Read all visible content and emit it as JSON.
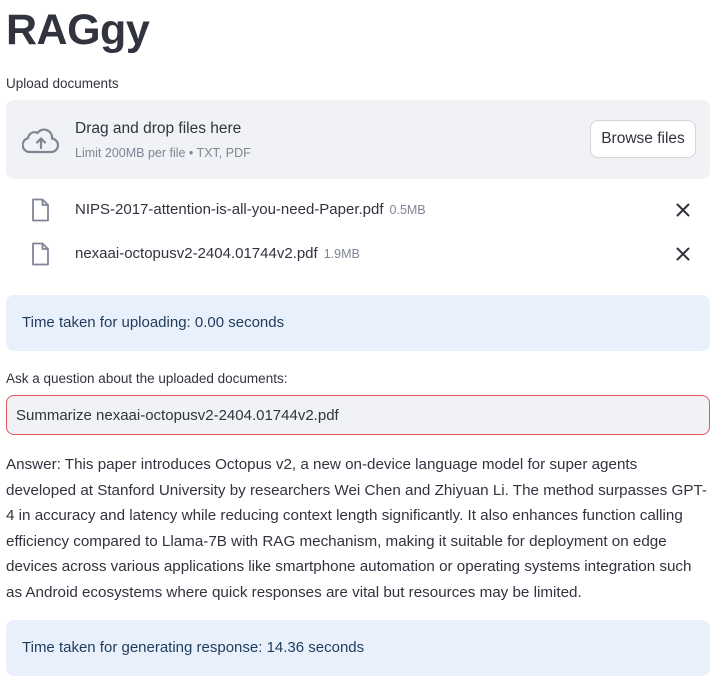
{
  "app": {
    "title": "RAGgy"
  },
  "uploader": {
    "label": "Upload documents",
    "drop_text": "Drag and drop files here",
    "limit_text": "Limit 200MB per file • TXT, PDF",
    "browse_label": "Browse files",
    "icon": "cloud-upload-icon"
  },
  "files": [
    {
      "name": "NIPS-2017-attention-is-all-you-need-Paper.pdf",
      "size": "0.5MB",
      "icon": "file-icon",
      "remove_icon": "close-icon"
    },
    {
      "name": "nexaai-octopusv2-2404.01744v2.pdf",
      "size": "1.9MB",
      "icon": "file-icon",
      "remove_icon": "close-icon"
    }
  ],
  "upload_info": {
    "text": "Time taken for uploading: 0.00 seconds"
  },
  "question": {
    "label": "Ask a question about the uploaded documents:",
    "value": "Summarize nexaai-octopusv2-2404.01744v2.pdf"
  },
  "answer": {
    "text": "Answer: This paper introduces Octopus v2, a new on-device language model for super agents developed at Stanford University by researchers Wei Chen and Zhiyuan Li. The method surpasses GPT-4 in accuracy and latency while reducing context length significantly. It also enhances function calling efficiency compared to Llama-7B with RAG mechanism, making it suitable for deployment on edge devices across various applications like smartphone automation or operating systems integration such as Android ecosystems where quick responses are vital but resources may be limited."
  },
  "response_info": {
    "text": "Time taken for generating response: 14.36 seconds"
  },
  "colors": {
    "text": "#31333F",
    "muted": "#808495",
    "dropzone_bg": "#F0F2F6",
    "info_bg": "#E8F1FB",
    "info_text": "#1F3B5C",
    "input_border_focus": "#E0575C"
  }
}
